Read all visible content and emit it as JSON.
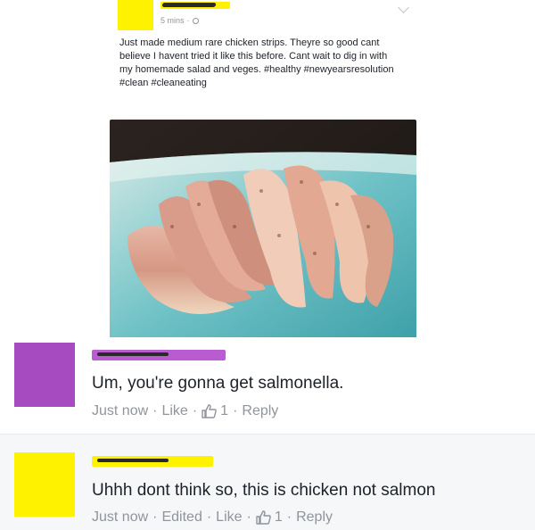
{
  "post": {
    "time": "5 mins",
    "text": "Just made medium rare chicken strips. Theyre so good cant believe I havent tried it like this before. Cant wait to dig in with my homemade salad and veges. #healthy #newyearsresolution #clean #cleaneating",
    "image_icon": "chicken-strips-photo"
  },
  "comments": [
    {
      "text": "Um, you're gonna get salmonella.",
      "time": "Just now",
      "like_label": "Like",
      "likes": "1",
      "reply_label": "Reply",
      "avatar_color": "#a64bc0"
    },
    {
      "text": "Uhhh dont think so, this is chicken not salmon",
      "time": "Just now",
      "edited_label": "Edited",
      "like_label": "Like",
      "likes": "1",
      "reply_label": "Reply",
      "avatar_color": "#fff200"
    }
  ],
  "colors": {
    "redaction_yellow": "#fff200",
    "redaction_purple": "#b95bd1",
    "meta_gray": "#90949c"
  }
}
